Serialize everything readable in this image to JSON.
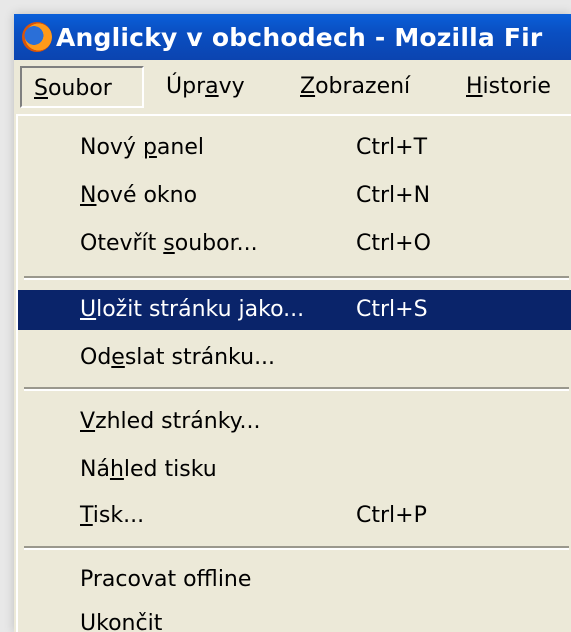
{
  "window": {
    "title": "Anglicky v obchodech - Mozilla Fir",
    "icon": "firefox-icon"
  },
  "menubar": {
    "items": [
      {
        "pre": "",
        "u": "S",
        "post": "oubor",
        "active": true
      },
      {
        "pre": "Úpr",
        "u": "a",
        "post": "vy",
        "active": false
      },
      {
        "pre": "",
        "u": "Z",
        "post": "obrazení",
        "active": false
      },
      {
        "pre": "",
        "u": "H",
        "post": "istorie",
        "active": false
      }
    ]
  },
  "menu": {
    "new_tab": {
      "pre": "Nový ",
      "u": "p",
      "post": "anel",
      "shortcut": "Ctrl+T"
    },
    "new_window": {
      "pre": "",
      "u": "N",
      "post": "ové okno",
      "shortcut": "Ctrl+N"
    },
    "open_file": {
      "pre": "Otevřít ",
      "u": "s",
      "post": "oubor...",
      "shortcut": "Ctrl+O"
    },
    "save_page": {
      "pre": "",
      "u": "U",
      "post": "ložit stránku jako...",
      "shortcut": "Ctrl+S"
    },
    "send_page": {
      "pre": "Od",
      "u": "e",
      "post": "slat stránku..."
    },
    "page_setup": {
      "pre": "",
      "u": "V",
      "post": "zhled stránky..."
    },
    "print_preview": {
      "pre": "Ná",
      "u": "h",
      "post": "led tisku"
    },
    "print": {
      "pre": "",
      "u": "T",
      "post": "isk...",
      "shortcut": "Ctrl+P"
    },
    "work_offline": {
      "pre": "Pracovat off",
      "u": "l",
      "post": "ine"
    },
    "quit": {
      "pre": "U",
      "u": "k",
      "post": "ončit"
    }
  },
  "colors": {
    "titlebar": "#0a4fc2",
    "menu_bg": "#ece9d8",
    "highlight": "#0a246a"
  }
}
